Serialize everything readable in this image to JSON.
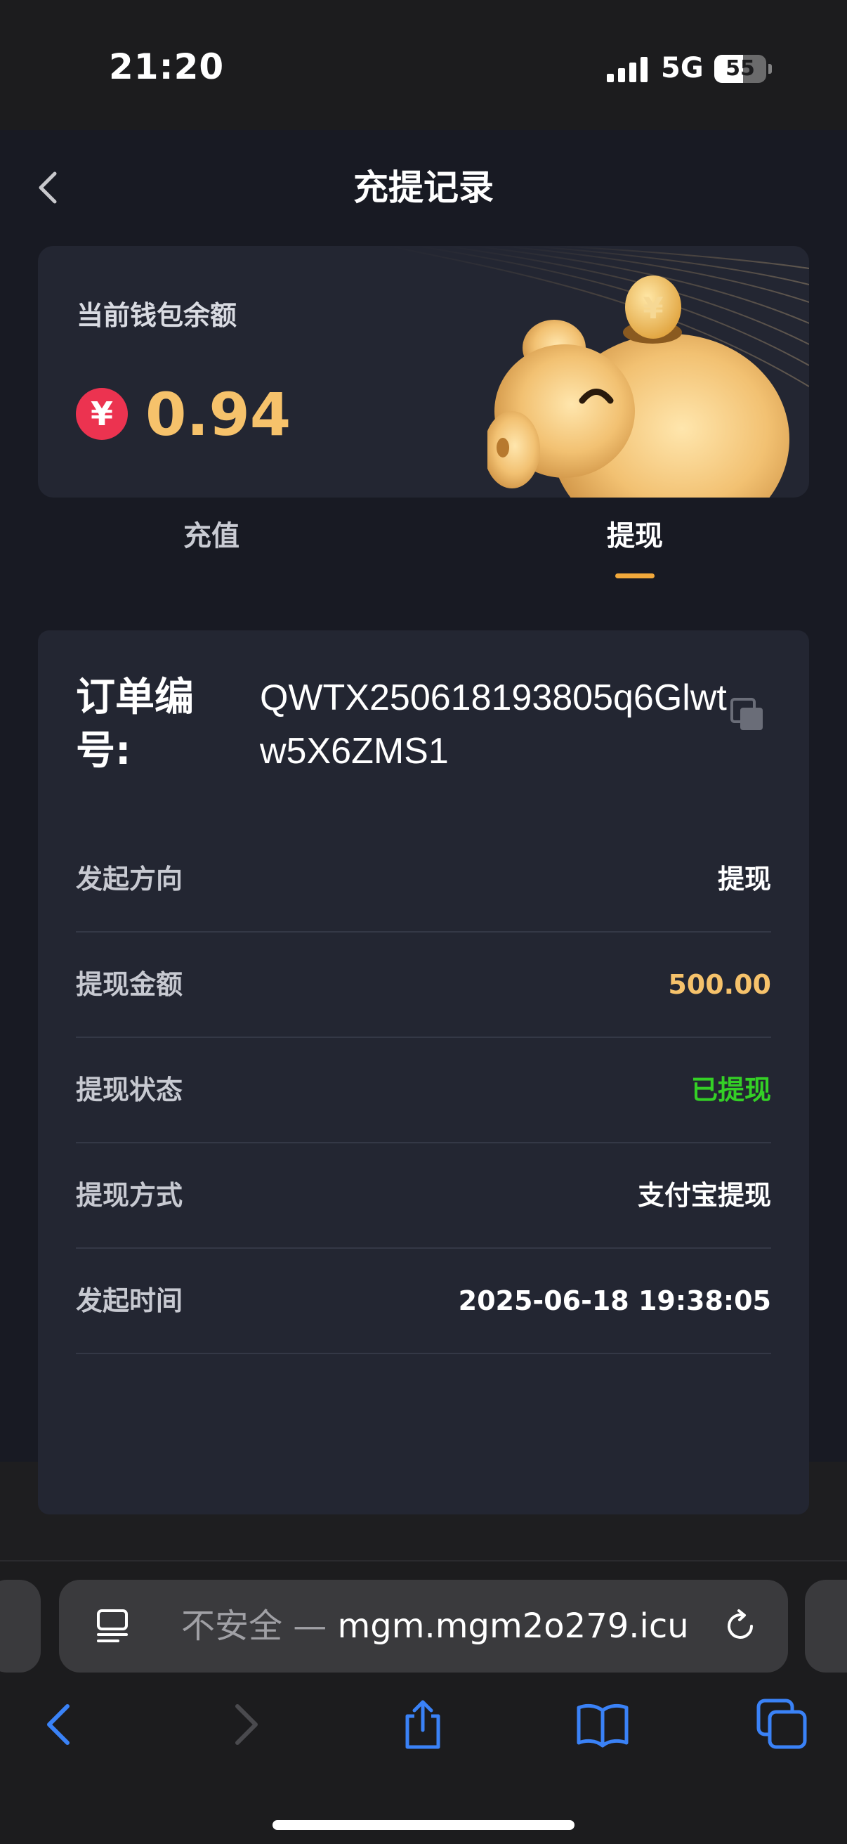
{
  "status_bar": {
    "time": "21:20",
    "network": "5G",
    "battery": "55",
    "battery_level": 0.55
  },
  "header": {
    "title": "充提记录"
  },
  "wallet": {
    "label": "当前钱包余额",
    "currency_symbol": "¥",
    "balance": "0.94"
  },
  "tabs": [
    {
      "label": "充值",
      "active": false
    },
    {
      "label": "提现",
      "active": true
    }
  ],
  "order": {
    "label": "订单编号:",
    "number": "QWTX250618193805q6Glwtw5X6ZMS1",
    "details": [
      {
        "key": "发起方向",
        "value": "提现"
      },
      {
        "key": "提现金额",
        "value": "500.00"
      },
      {
        "key": "提现状态",
        "value": "已提现"
      },
      {
        "key": "提现方式",
        "value": "支付宝提现"
      },
      {
        "key": "发起时间",
        "value": "2025-06-18 19:38:05"
      }
    ]
  },
  "browser": {
    "insecure_label": "不安全 — ",
    "domain": "mgm.mgm2o279.icu"
  },
  "colors": {
    "accent": "#f2a93b",
    "amount": "#f6c26b",
    "success": "#34d026",
    "yen_badge": "#ec3350",
    "ios_blue": "#3a82f7"
  }
}
